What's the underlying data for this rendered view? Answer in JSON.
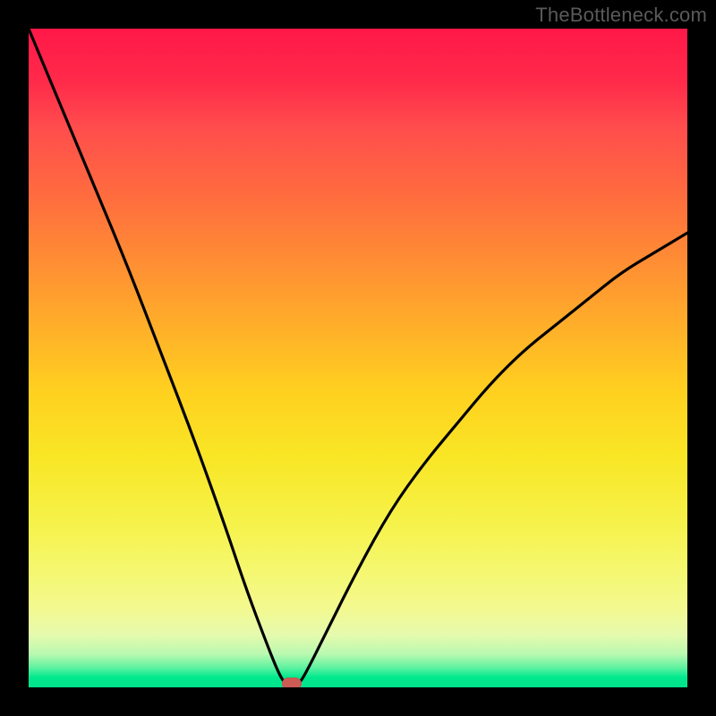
{
  "watermark": "TheBottleneck.com",
  "chart_data": {
    "type": "line",
    "title": "",
    "xlabel": "",
    "ylabel": "",
    "xlim": [
      0,
      100
    ],
    "ylim": [
      0,
      100
    ],
    "grid": false,
    "series": [
      {
        "name": "bottleneck-curve",
        "x": [
          0,
          5,
          10,
          15,
          20,
          25,
          30,
          33,
          36,
          38,
          39,
          40,
          41,
          42,
          45,
          50,
          55,
          60,
          65,
          70,
          75,
          80,
          85,
          90,
          95,
          100
        ],
        "y": [
          100,
          88,
          76,
          64,
          51,
          38,
          24,
          15,
          7,
          2,
          0.5,
          0,
          0.5,
          2,
          8,
          18,
          27,
          34,
          40,
          46,
          51,
          55,
          59,
          63,
          66,
          69
        ]
      }
    ],
    "marker": {
      "x": 40,
      "y": 0,
      "name": "optimal-point"
    },
    "colors": {
      "curve": "#000000",
      "marker": "#cc5b55",
      "gradient_top": "#ff1848",
      "gradient_bottom": "#00e28a"
    }
  }
}
